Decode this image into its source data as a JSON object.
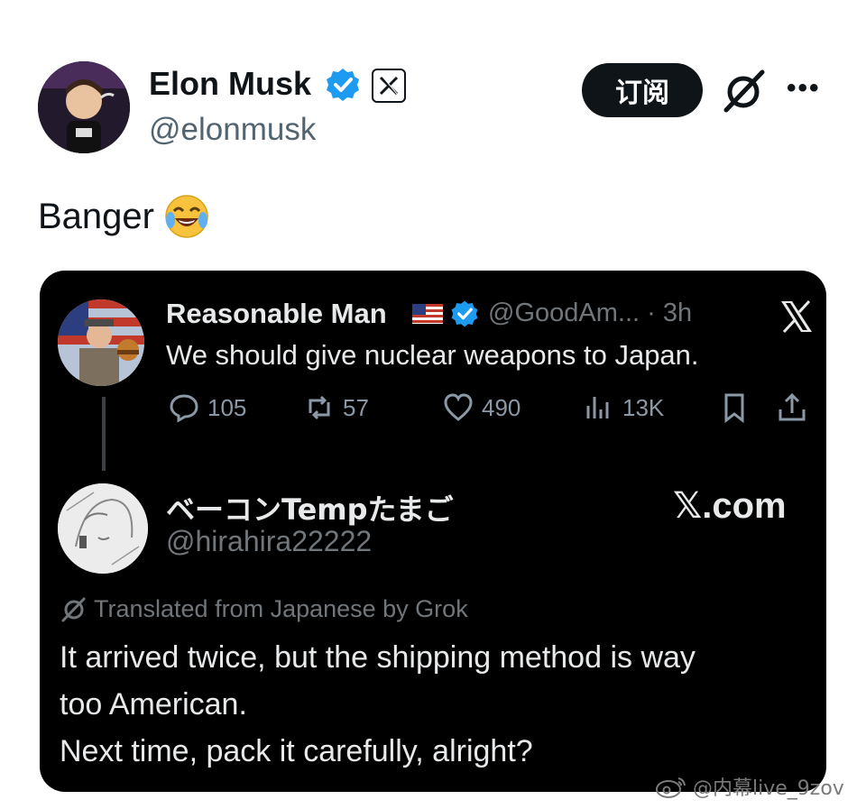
{
  "author": {
    "name": "Elon Musk",
    "handle": "@elonmusk",
    "subscribe_label": "订阅",
    "more_label": "•••"
  },
  "post": {
    "text": "Banger"
  },
  "quoted_card": {
    "original": {
      "name": "Reasonable Man",
      "handle_time": "@GoodAm... · 3h",
      "text": "We should give nuclear weapons to Japan.",
      "replies": "105",
      "reposts": "57",
      "likes": "490",
      "views": "13K"
    },
    "reply": {
      "name": "ベーコンTempたまご",
      "handle": "@hirahira22222",
      "site_label": "𝕏.com",
      "translated_note": "Translated from Japanese by Grok",
      "lines": [
        "It arrived twice, but the shipping method is way",
        "too American.",
        "Next time, pack it carefully, alright?"
      ]
    }
  },
  "watermark": {
    "text": "@内幕live_9zov"
  },
  "colors": {
    "verified": "#1d9bf0",
    "card_bg": "#000000",
    "muted": "#71767b"
  },
  "icons": [
    "verified-badge-icon",
    "x-logo-icon",
    "grok-icon",
    "more-icon",
    "reply-icon",
    "repost-icon",
    "like-icon",
    "views-icon",
    "bookmark-icon",
    "share-icon",
    "us-flag-icon",
    "weibo-icon",
    "laughing-emoji-icon"
  ]
}
